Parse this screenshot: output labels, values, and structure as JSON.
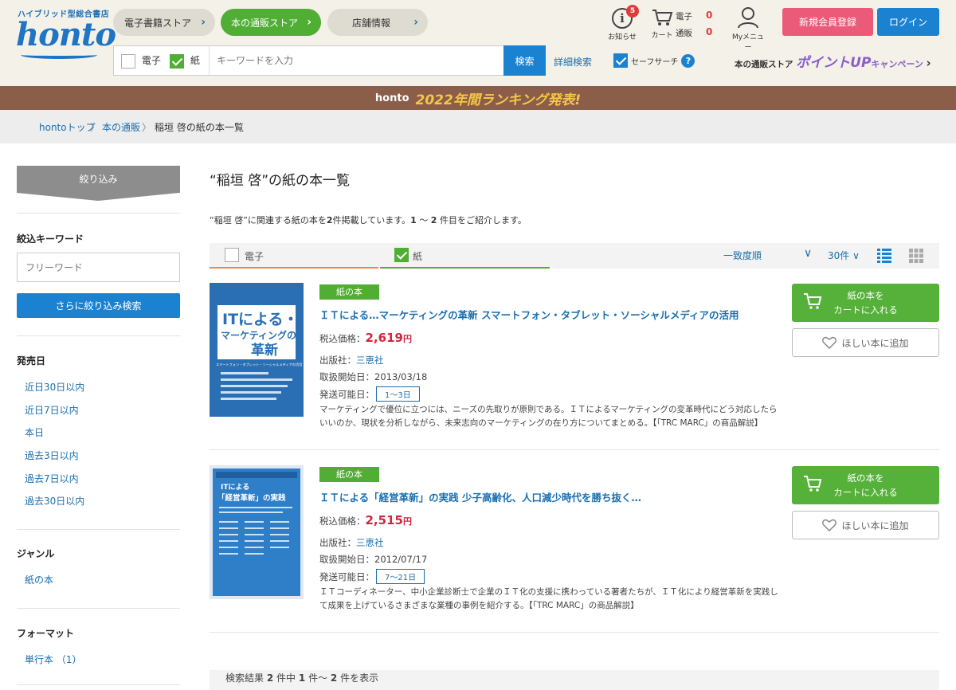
{
  "header": {
    "tagline": "ハイブリッド型総合書店",
    "logo": "honto",
    "nav": [
      {
        "label": "電子書籍ストア"
      },
      {
        "label": "本の通販ストア"
      },
      {
        "label": "店舗情報"
      }
    ],
    "notice_label": "お知らせ",
    "notice_count": "5",
    "cart_label": "カート",
    "cart_ebook_label": "電子",
    "cart_ebook_count": "0",
    "cart_mail_label": "通販",
    "cart_mail_count": "0",
    "mymenu_label": "Myメニュー",
    "register_label": "新規会員登録",
    "login_label": "ログイン",
    "search": {
      "opt_ebook": "電子",
      "opt_paper": "紙",
      "placeholder": "キーワードを入力",
      "button": "検索",
      "advanced": "詳細検索",
      "safe_search": "セーフサーチ",
      "help": "?"
    },
    "campaign_prefix": "本の通販ストア",
    "campaign_big": "ポイントUP",
    "campaign_suffix": "キャンペーン",
    "campaign_chev": "›"
  },
  "banner": {
    "brand": "honto",
    "text": "2022年間ランキング発表!"
  },
  "breadcrumb": {
    "items": [
      "hontoトップ",
      "本の通販",
      "稲垣 啓の紙の本一覧"
    ],
    "sep": "〉"
  },
  "sidebar": {
    "filter_head": "絞り込み",
    "keyword_title": "絞込キーワード",
    "keyword_placeholder": "フリーワード",
    "keyword_button": "さらに絞り込み検索",
    "date_title": "発売日",
    "date_items": [
      "近日30日以内",
      "近日7日以内",
      "本日",
      "過去3日以内",
      "過去7日以内",
      "過去30日以内"
    ],
    "genre_title": "ジャンル",
    "genre_items": [
      "紙の本"
    ],
    "format_title": "フォーマット",
    "format_items": [
      "単行本 （1）"
    ]
  },
  "main": {
    "title": "“稲垣 啓”の紙の本一覧",
    "summary_pre": "“稲垣 啓”に関連する紙の本を",
    "summary_count": "2",
    "summary_mid": "件掲載しています。",
    "summary_from": "1",
    "summary_tilde": "〜",
    "summary_to": "2",
    "summary_post": "件目をご紹介します。",
    "tab_ebook": "電子",
    "tab_paper": "紙",
    "sort": "一致度順",
    "per_page": "30件",
    "chev": "∨"
  },
  "items": [
    {
      "tag": "紙の本",
      "title": "ＩＴによる…マーケティングの革新 スマートフォン・タブレット・ソーシャルメディアの活用",
      "price_label": "税込価格：",
      "price": "2,619",
      "price_unit": "円",
      "publisher_label": "出版社：",
      "publisher": "三恵社",
      "date_label": "取扱開始日：",
      "date": "2013/03/18",
      "ship_label": "発送可能日：",
      "ship": "1〜3日",
      "desc": "マーケティングで優位に立つには、ニーズの先取りが原則である。ＩＴによるマーケティングの変革時代にどう対応したらいいのか、現状を分析しながら、未来志向のマーケティングの在り方についてまとめる。【「TRC MARC」の商品解説】",
      "cart_label_1": "紙の本を",
      "cart_label_2": "カートに入れる",
      "wish_label": "ほしい本に追加",
      "cover": {
        "line1": "ITによる・・・",
        "line2": "マーケティングの",
        "line3": "革新",
        "sub": "スマートフォン・タブレット・ソーシャルメディアの活用",
        "color": "#2a6fb3"
      }
    },
    {
      "tag": "紙の本",
      "title": "ＩＴによる「経営革新」の実践 少子高齢化、人口減少時代を勝ち抜く…",
      "price_label": "税込価格：",
      "price": "2,515",
      "price_unit": "円",
      "publisher_label": "出版社：",
      "publisher": "三恵社",
      "date_label": "取扱開始日：",
      "date": "2012/07/17",
      "ship_label": "発送可能日：",
      "ship": "7〜21日",
      "desc": "ＩＴコーディネーター、中小企業診断士で企業のＩＴ化の支援に携わっている著者たちが、ＩＴ化により経営革新を実践して成果を上げているさまざまな業種の事例を紹介する。【「TRC MARC」の商品解説】",
      "cart_label_1": "紙の本を",
      "cart_label_2": "カートに入れる",
      "wish_label": "ほしい本に追加",
      "cover": {
        "line1": "ITによる",
        "line2": "「経営革新」の実践",
        "color": "#2a6fb3"
      }
    }
  ],
  "footer": {
    "pre": "検索結果",
    "total": "2",
    "mid1": "件中",
    "from": "1",
    "tilde": "件〜",
    "to": "2",
    "post": "件を表示"
  }
}
